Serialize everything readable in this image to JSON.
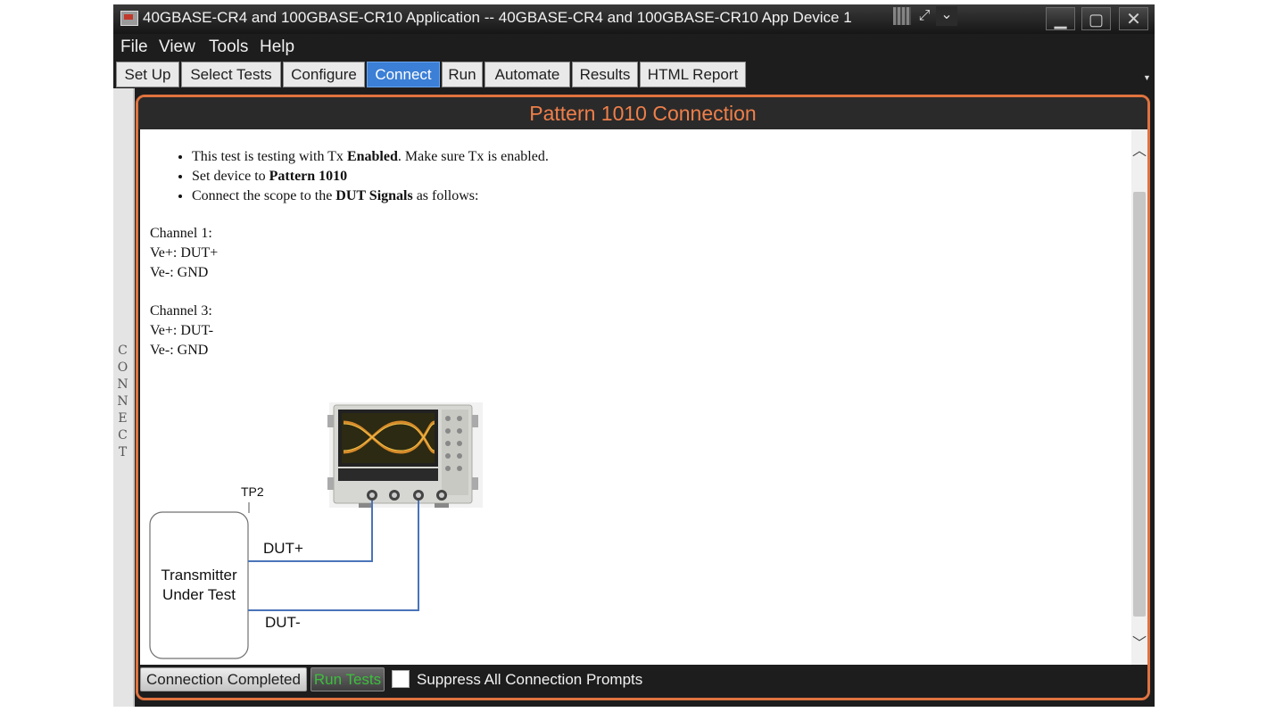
{
  "window": {
    "title": "40GBASE-CR4 and 100GBASE-CR10 Application -- 40GBASE-CR4 and 100GBASE-CR10 App Device 1",
    "icons": [
      "app-icon",
      "grid-icon",
      "expand-icon",
      "chevron-down-icon",
      "minimize-icon",
      "maximize-icon",
      "close-icon"
    ]
  },
  "menu": {
    "items": [
      "File",
      "View",
      "Tools",
      "Help"
    ]
  },
  "tabs": {
    "items": [
      "Set Up",
      "Select Tests",
      "Configure",
      "Connect",
      "Run",
      "Automate",
      "Results",
      "HTML Report"
    ],
    "active": "Connect"
  },
  "side_panel": {
    "label": "CONNECT"
  },
  "dialog": {
    "title": "Pattern 1010 Connection",
    "bullets": [
      {
        "pre": "This test is testing with Tx ",
        "bold": "Enabled",
        "post": ". Make sure Tx is enabled."
      },
      {
        "pre": "Set device to ",
        "bold": "Pattern 1010",
        "post": ""
      },
      {
        "pre": "Connect the scope to the ",
        "bold": "DUT Signals",
        "post": " as follows:"
      }
    ],
    "channels": [
      {
        "name": "Channel 1:",
        "pos": "Ve+: DUT+",
        "neg": "Ve-: GND"
      },
      {
        "name": "Channel 3:",
        "pos": "Ve+: DUT-",
        "neg": "Ve-: GND"
      }
    ],
    "diagram": {
      "tp_label": "TP2",
      "device_label_line1": "Transmitter",
      "device_label_line2": "Under Test",
      "pos_signal": "DUT+",
      "neg_signal": "DUT-"
    }
  },
  "bottom": {
    "connection_completed": "Connection Completed",
    "run_tests": "Run Tests",
    "suppress_label": "Suppress All Connection Prompts",
    "suppress_checked": false
  },
  "colors": {
    "accent_orange": "#e0733f",
    "tab_active": "#3b7fd6",
    "run_tests_text": "#3dbf3d",
    "wire_blue": "#4a74b8"
  }
}
